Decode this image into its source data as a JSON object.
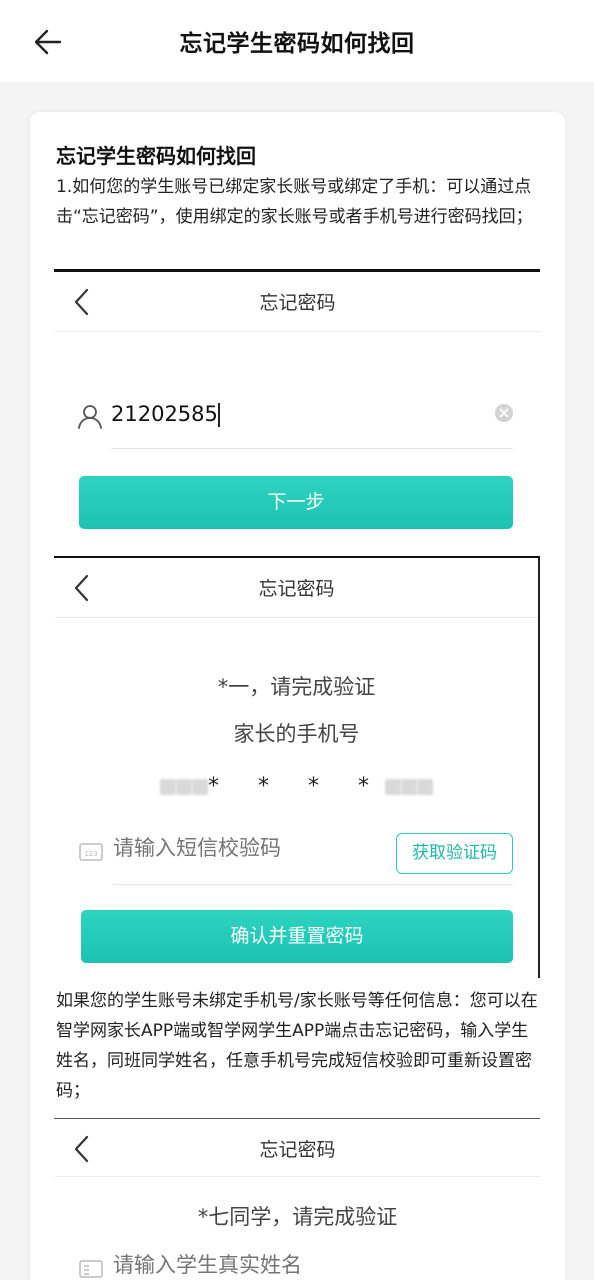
{
  "header": {
    "title": "忘记学生密码如何找回"
  },
  "article": {
    "title": "忘记学生密码如何找回",
    "para1": "1.如何您的学生账号已绑定家长账号或绑定了手机：可以通过点击“忘记密码”，使用绑定的家长账号或者手机号进行密码找回；",
    "para2": "如果您的学生账号未绑定手机号/家长账号等任何信息：您可以在智学网家长APP端或智学网学生APP端点击忘记密码，输入学生姓名，同班同学姓名，任意手机号完成短信校验即可重新设置密码；"
  },
  "shot1": {
    "title": "忘记密码",
    "account_value": "21202585",
    "next_label": "下一步"
  },
  "shot2": {
    "title": "忘记密码",
    "step_text": "*一，请完成验证",
    "subtitle": "家长的手机号",
    "masked_phone": "* * * *",
    "sms_placeholder": "请输入短信校验码",
    "get_code_label": "获取验证码",
    "confirm_label": "确认并重置密码"
  },
  "shot3": {
    "title": "忘记密码",
    "step_text": "*七同学，请完成验证",
    "name_placeholder": "请输入学生真实姓名"
  },
  "colors": {
    "accent": "#1cc3b2",
    "accent_border": "#2ccdbb"
  }
}
